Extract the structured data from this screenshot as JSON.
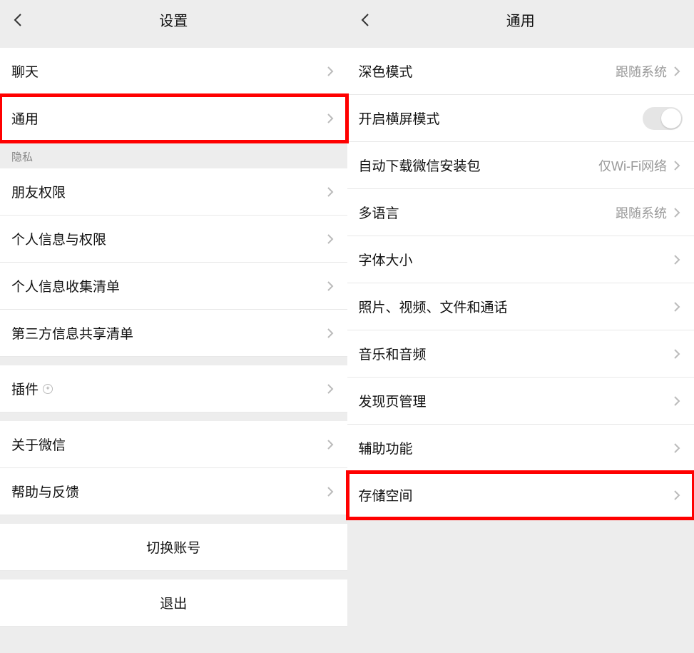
{
  "left": {
    "title": "设置",
    "rows": {
      "chat": "聊天",
      "general": "通用",
      "privacy_header": "隐私",
      "friend_perm": "朋友权限",
      "personal_info_perm": "个人信息与权限",
      "personal_info_list": "个人信息收集清单",
      "third_party_share": "第三方信息共享清单",
      "plugins": "插件",
      "about": "关于微信",
      "help": "帮助与反馈",
      "switch_account": "切换账号",
      "logout": "退出"
    }
  },
  "right": {
    "title": "通用",
    "rows": {
      "dark_mode": {
        "label": "深色模式",
        "value": "跟随系统"
      },
      "landscape": {
        "label": "开启横屏模式"
      },
      "auto_download": {
        "label": "自动下载微信安装包",
        "value": "仅Wi-Fi网络"
      },
      "multilang": {
        "label": "多语言",
        "value": "跟随系统"
      },
      "font_size": {
        "label": "字体大小"
      },
      "media": {
        "label": "照片、视频、文件和通话"
      },
      "music": {
        "label": "音乐和音频"
      },
      "discover": {
        "label": "发现页管理"
      },
      "accessibility": {
        "label": "辅助功能"
      },
      "storage": {
        "label": "存储空间"
      }
    }
  }
}
